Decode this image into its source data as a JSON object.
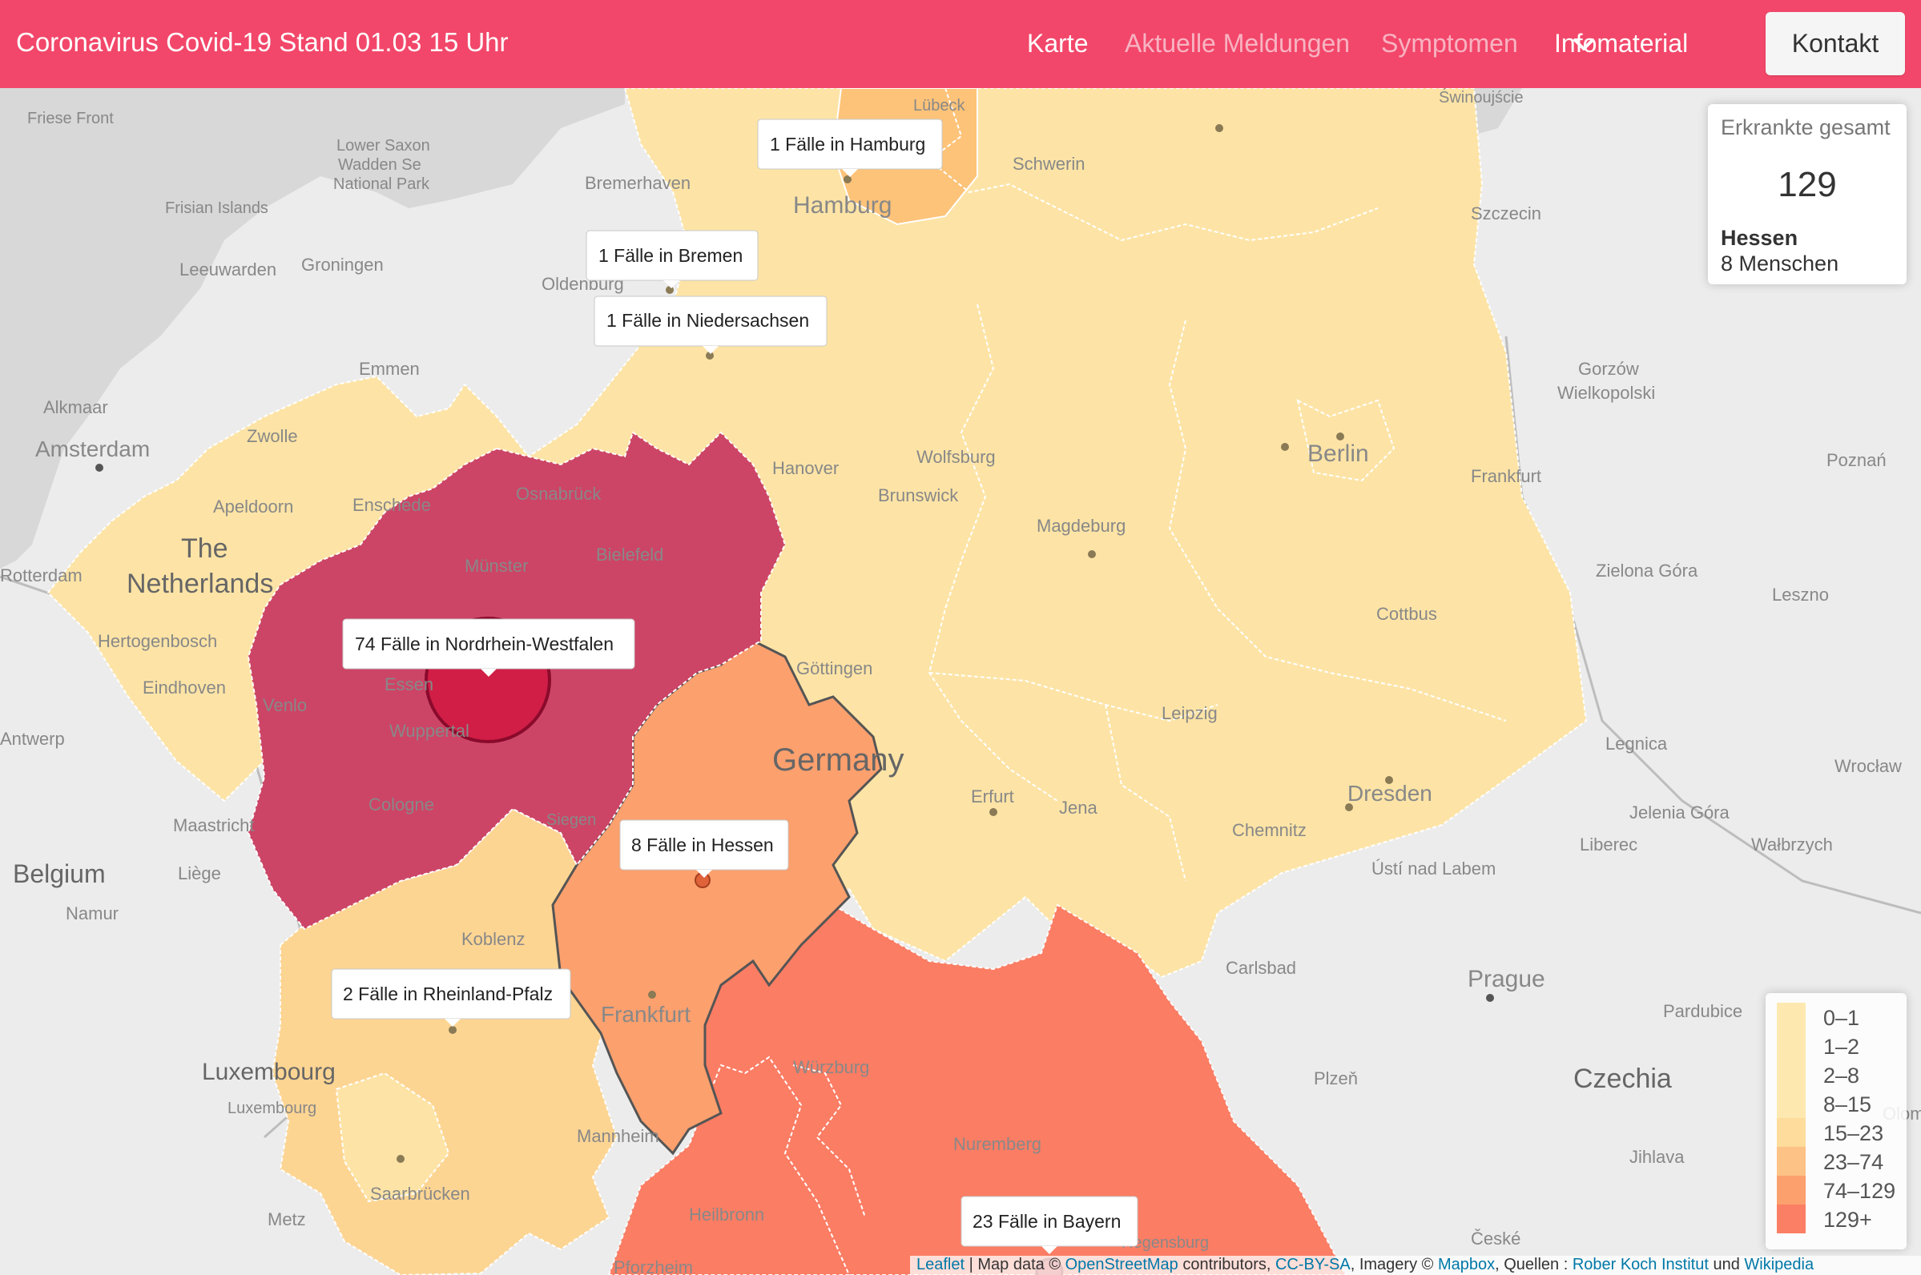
{
  "header": {
    "brand": "Coronavirus Covid-19  Stand 01.03 15 Uhr",
    "nav": [
      {
        "label": "Karte",
        "active": true
      },
      {
        "label": "Aktuelle Meldungen",
        "active": false
      },
      {
        "label": "Symptomen",
        "active": false
      },
      {
        "label": "Infomaterial",
        "active": true,
        "icon": "chevron-down-icon"
      }
    ],
    "contact_label": "Kontakt",
    "colors": {
      "bar": "#f2476a",
      "text_active": "#ffffff",
      "text_dim": "#f8b3c2"
    }
  },
  "info": {
    "title": "Erkrankte gesamt",
    "total": "129",
    "selected_state": "Hessen",
    "selected_people": "8 Menschen"
  },
  "legend": [
    {
      "label": "0–1",
      "color": "#fde9b0"
    },
    {
      "label": "1–2",
      "color": "#fde9b0"
    },
    {
      "label": "2–8",
      "color": "#fde9b0"
    },
    {
      "label": "8–15",
      "color": "#fde9b0"
    },
    {
      "label": "15–23",
      "color": "#fddc9c"
    },
    {
      "label": "23–74",
      "color": "#fdc286"
    },
    {
      "label": "74–129",
      "color": "#fca06e"
    },
    {
      "label": "129+",
      "color": "#fb7f65"
    }
  ],
  "state_colors": {
    "low": "#fde4a6",
    "rheinland": "#fdd593",
    "hamburg": "#fdc379",
    "hessen": "#fca06e",
    "bayern": "#fb7d64",
    "bw": "#fb7d64",
    "nrw": "#cc4566",
    "nrw_circle": "#d01c45",
    "sea": "#d8d8d8"
  },
  "tooltips": [
    {
      "text": "1 Fälle in Hamburg"
    },
    {
      "text": "1 Fälle in Bremen"
    },
    {
      "text": "1 Fälle in Niedersachsen"
    },
    {
      "text": "74 Fälle in Nordrhein-Westfalen"
    },
    {
      "text": "8 Fälle in Hessen"
    },
    {
      "text": "2 Fälle in Rheinland-Pfalz"
    },
    {
      "text": "23 Fälle in Bayern"
    }
  ],
  "place_labels": [
    "Friese Front",
    "Lower Saxon",
    "Wadden Se",
    "National Park",
    "Frisian Islands",
    "Leeuwarden",
    "Groningen",
    "Alkmaar",
    "Amsterdam",
    "Zwolle",
    "Apeldoorn",
    "Emmen",
    "The",
    "Netherlands",
    "Rotterdam",
    "Hertogenbosch",
    "Eindhoven",
    "Antwerp",
    "Belgium",
    "Maastricht",
    "Liège",
    "Namur",
    "Luxembourg",
    "Luxembourg",
    "Metz",
    "Lübeck",
    "Schwerin",
    "Bremerhaven",
    "Hamburg",
    "Oldenburg",
    "Szczecin",
    "Gorzów",
    "Wielkopolski",
    "Poznań",
    "Hanover",
    "Wolfsburg",
    "Brunswick",
    "Osnabrück",
    "Enschede",
    "Münster",
    "Bielefeld",
    "Berlin",
    "Frankfurt",
    "Magdeburg",
    "Zielona Góra",
    "Leszno",
    "Cottbus",
    "Essen",
    "Göttingen",
    "Venlo",
    "Wuppertal",
    "Germany",
    "Leipzig",
    "Legnica",
    "Wrocław",
    "Cologne",
    "Erfurt",
    "Jena",
    "Dresden",
    "Chemnitz",
    "Jelenia Góra",
    "Wałbrzych",
    "Liberec",
    "Ústí nad Labem",
    "Koblenz",
    "Carlsbad",
    "Prague",
    "Pardubice",
    "Frankfurt",
    "Würzburg",
    "Plzeň",
    "Czechia",
    "Jihlava",
    "Mannheim",
    "Nuremberg",
    "Heilbronn",
    "Saarbrücken",
    "Pforzheim",
    "České",
    "Olomo",
    "Świnoujście",
    "Siegen",
    "Regensburg"
  ],
  "attribution": {
    "leaflet": "Leaflet",
    "sep1": " | Map data © ",
    "osm": "OpenStreetMap",
    "sep2": " contributors, ",
    "license": "CC-BY-SA",
    "sep3": ", Imagery © ",
    "mapbox": "Mapbox",
    "sep4": ", Quellen : ",
    "rki": "Rober Koch Institut",
    "sep5": " und ",
    "wiki": "Wikipedia"
  }
}
